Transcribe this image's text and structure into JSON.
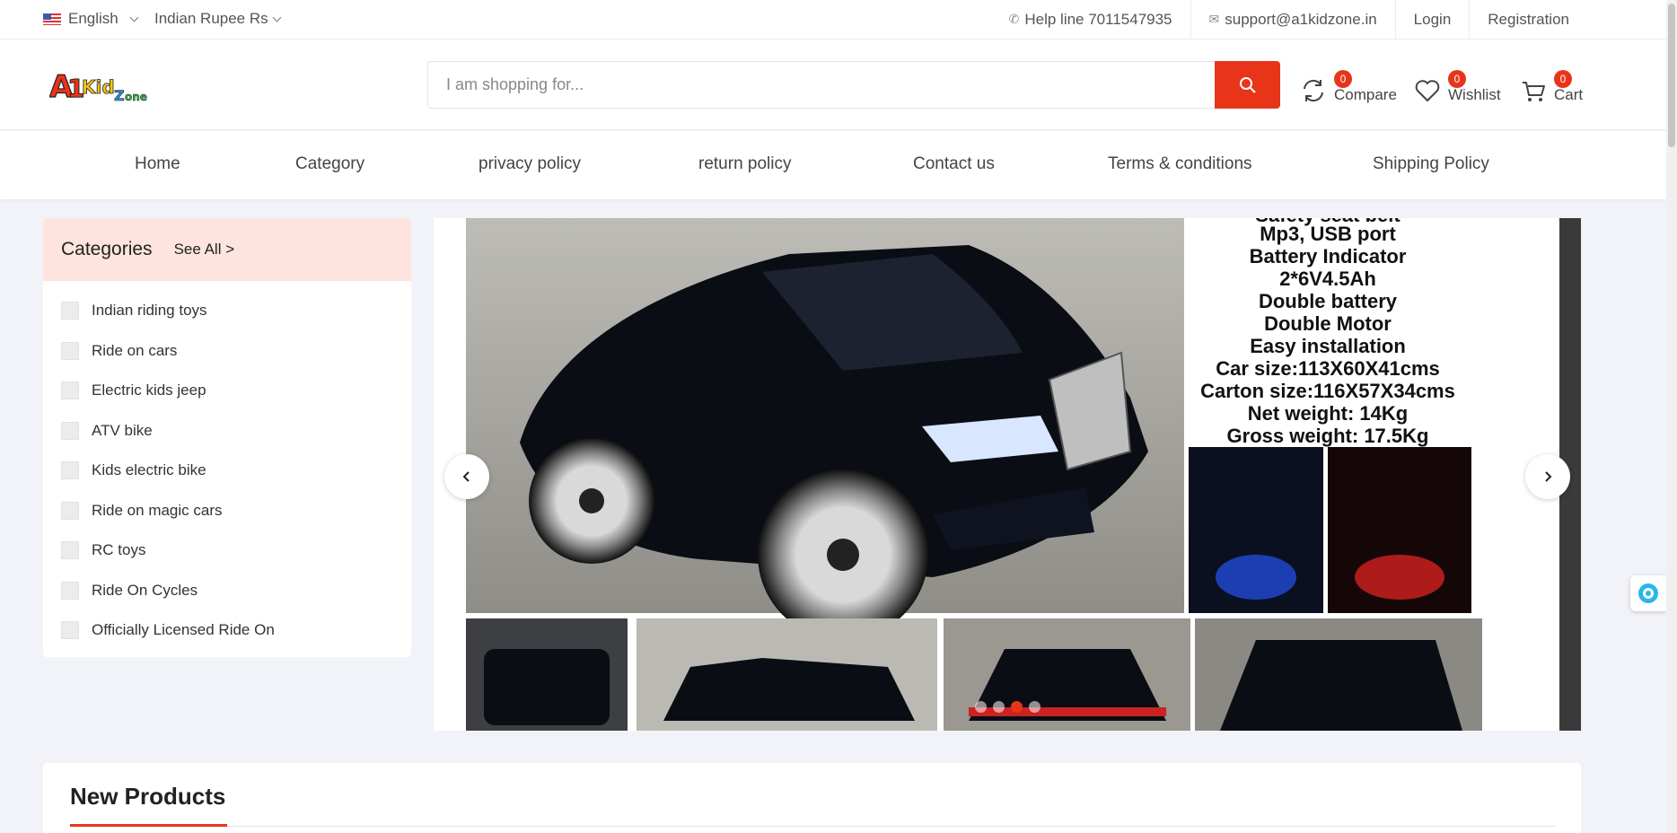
{
  "topbar": {
    "language": "English",
    "currency": "Indian Rupee Rs",
    "helpline": "Help line 7011547935",
    "email": "support@a1kidzone.in",
    "login": "Login",
    "registration": "Registration"
  },
  "header": {
    "logo_text": "A1 KidZone",
    "search_placeholder": "I am shopping for...",
    "compare": {
      "label": "Compare",
      "count": "0"
    },
    "wishlist": {
      "label": "Wishlist",
      "count": "0"
    },
    "cart": {
      "label": "Cart",
      "count": "0"
    }
  },
  "nav": [
    "Home",
    "Category",
    "privacy policy",
    "return policy",
    "Contact us",
    "Terms & conditions",
    "Shipping Policy"
  ],
  "categories": {
    "title": "Categories",
    "see_all": "See All >",
    "items": [
      "Indian riding toys",
      "Ride on cars",
      "Electric kids jeep",
      "ATV bike",
      "Kids electric bike",
      "Ride on magic cars",
      "RC toys",
      "Ride On Cycles",
      "Officially Licensed Ride On"
    ]
  },
  "slider": {
    "specs": [
      "Safety seat belt",
      "Mp3, USB port",
      "Battery Indicator",
      "2*6V4.5Ah",
      "Double battery",
      "Double Motor",
      "Easy installation",
      "Car size:113X60X41cms",
      "Carton size:116X57X34cms",
      "Net weight: 14Kg",
      "Gross weight: 17.5Kg"
    ],
    "active_dot": 2
  },
  "new_products": {
    "title": "New Products"
  },
  "colors": {
    "accent": "#e8351a",
    "category_header": "#fde4de"
  }
}
